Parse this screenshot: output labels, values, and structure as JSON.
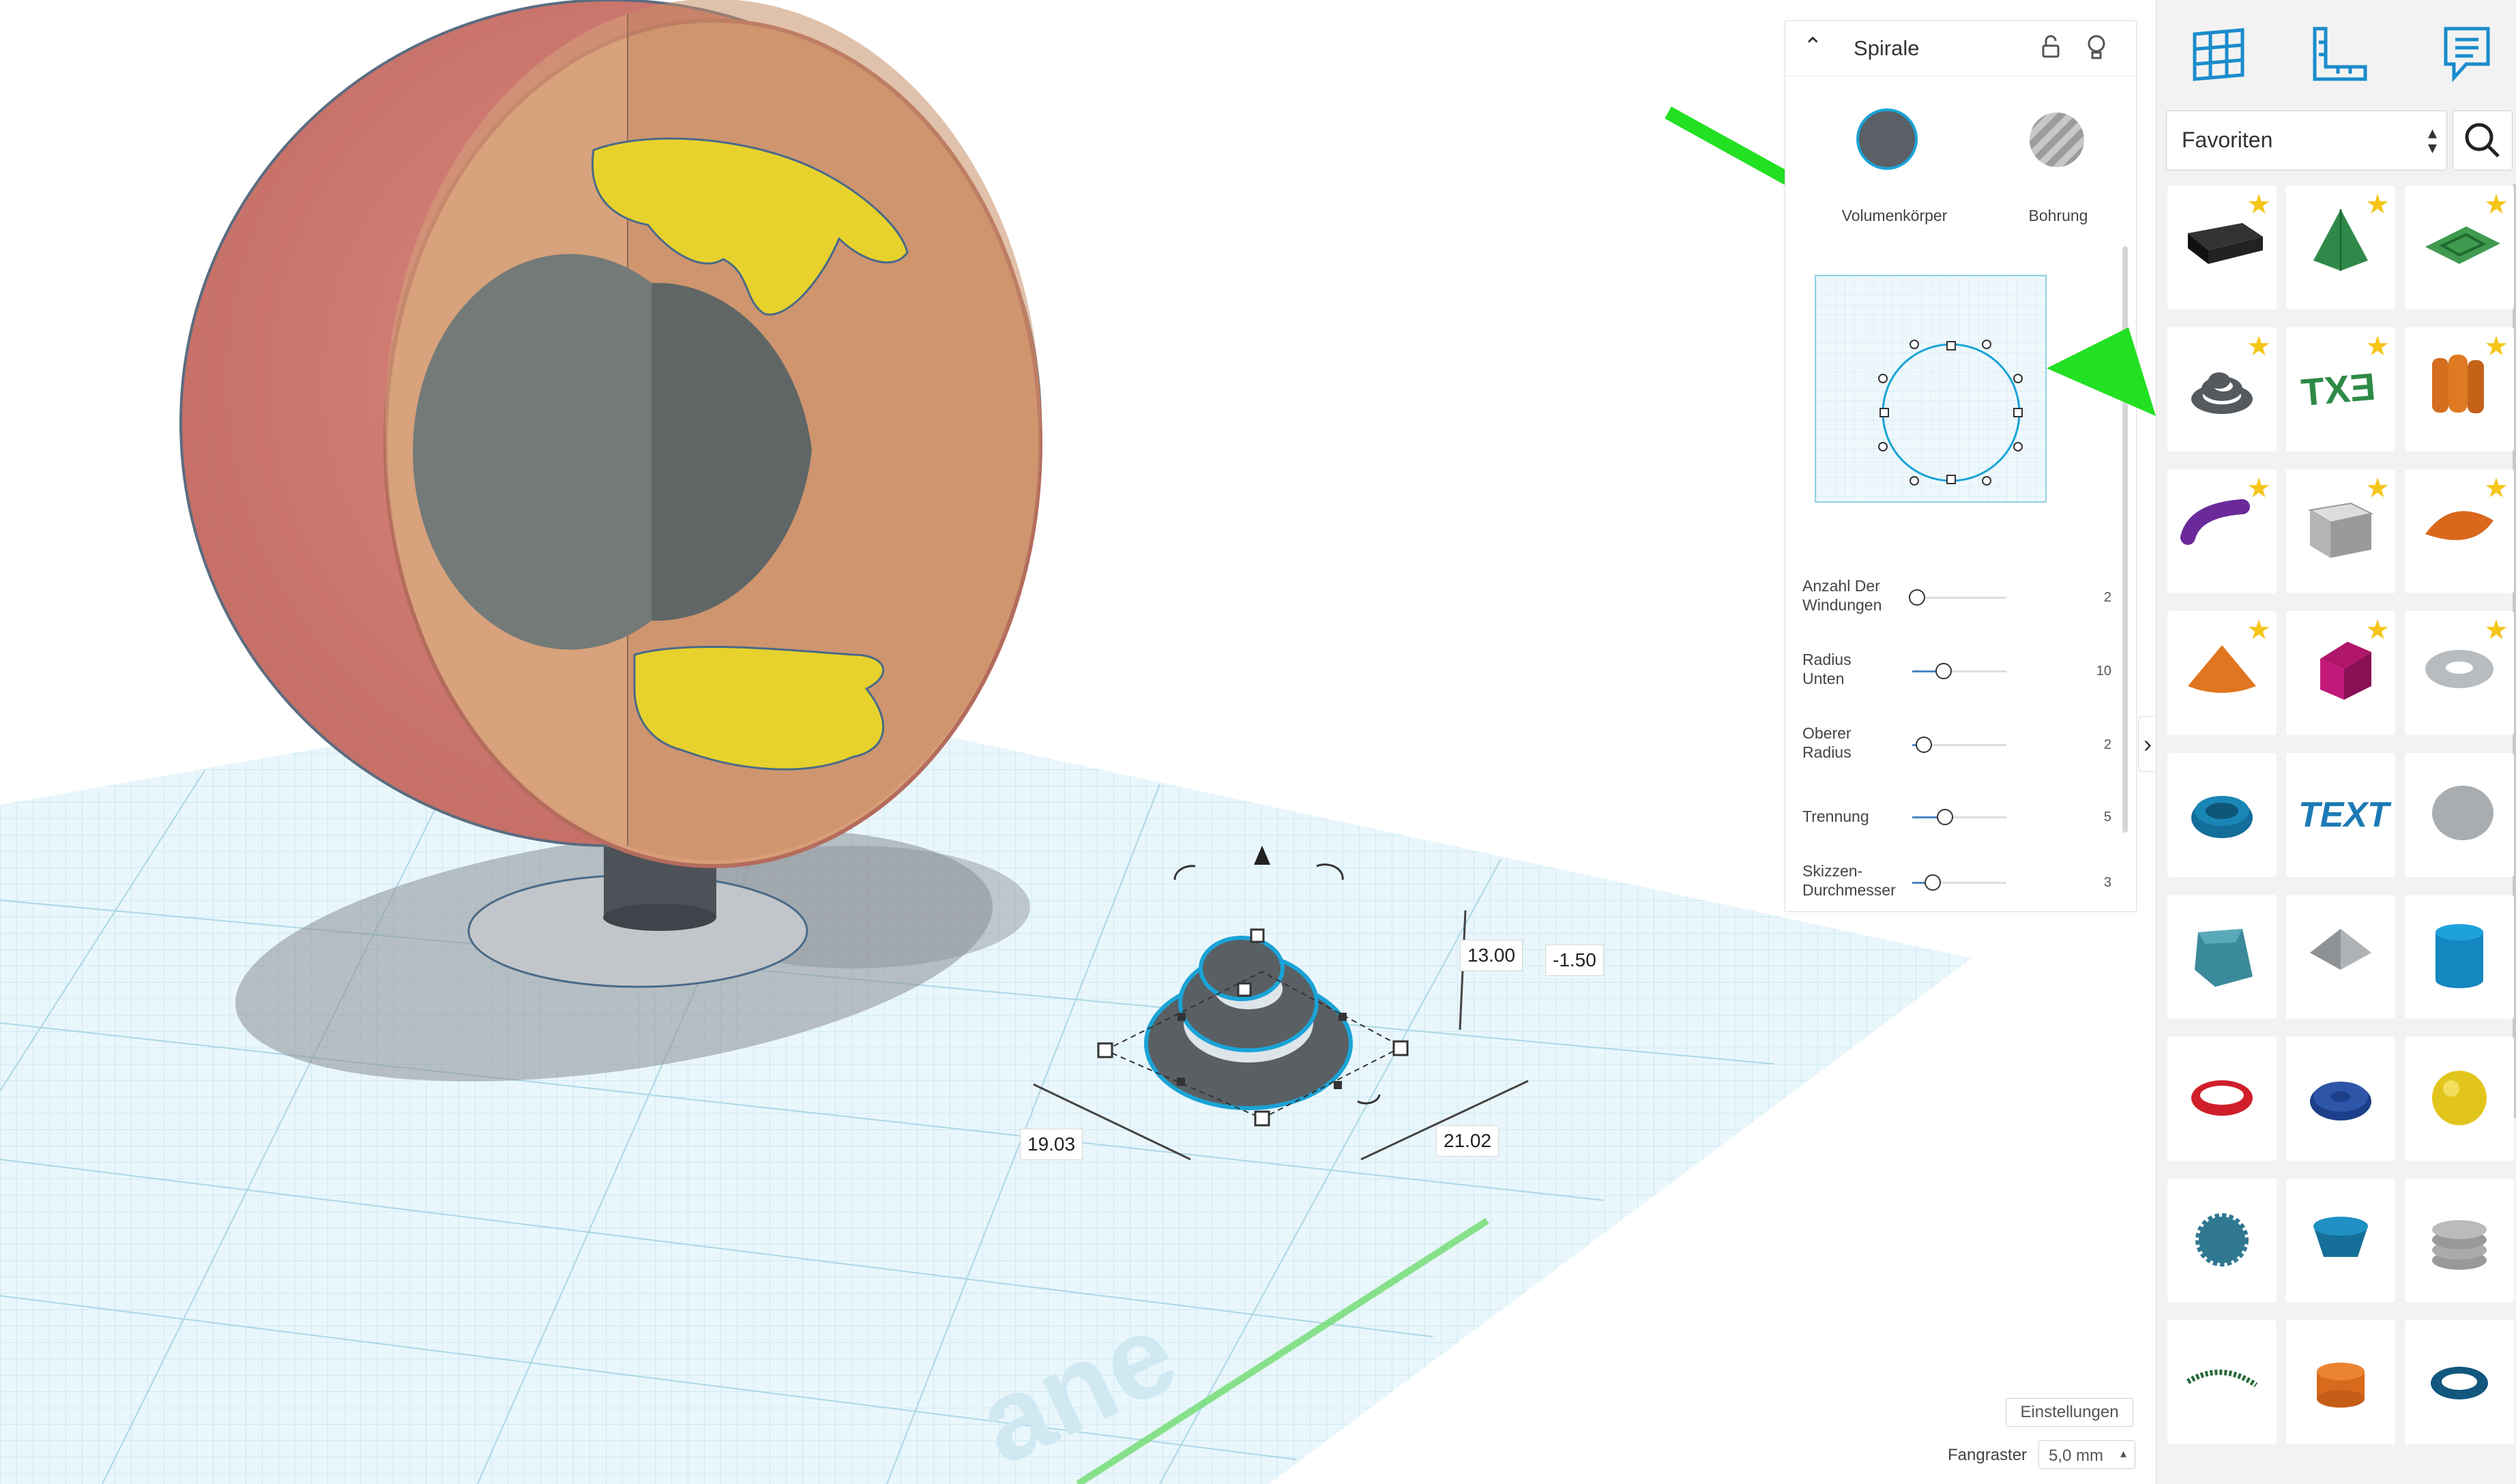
{
  "inspector": {
    "shape_name": "Spirale",
    "solid_label": "Volumenkörper",
    "hole_label": "Bohrung",
    "params": [
      {
        "label_line1": "Anzahl Der",
        "label_line2": "Windungen",
        "value": "2",
        "slider_fraction": 0.05
      },
      {
        "label_line1": "Radius",
        "label_line2": "Unten",
        "value": "10",
        "slider_fraction": 0.33
      },
      {
        "label_line1": "Oberer",
        "label_line2": "Radius",
        "value": "2",
        "slider_fraction": 0.12
      },
      {
        "label_line1": "Trennung",
        "label_line2": "",
        "value": "5",
        "slider_fraction": 0.35
      },
      {
        "label_line1": "Skizzen-",
        "label_line2": "Durchmesser",
        "value": "3",
        "slider_fraction": 0.22
      }
    ]
  },
  "dimensions": {
    "height": "13.00",
    "elevation": "-1.50",
    "length": "19.03",
    "width": "21.02"
  },
  "library": {
    "category": "Favoriten",
    "tool_icons": [
      "grid-icon",
      "ruler-icon",
      "notes-icon"
    ],
    "shapes": [
      {
        "name": "box-black",
        "favorite": true
      },
      {
        "name": "cone-green",
        "favorite": true
      },
      {
        "name": "square-spiral-green",
        "favorite": true
      },
      {
        "name": "spiral-gray",
        "favorite": true
      },
      {
        "name": "text-green",
        "favorite": true
      },
      {
        "name": "cylinders-orange",
        "favorite": true
      },
      {
        "name": "tube-purple",
        "favorite": true
      },
      {
        "name": "box-hollow-gray",
        "favorite": true
      },
      {
        "name": "leaf-orange",
        "favorite": true
      },
      {
        "name": "cone-orange",
        "favorite": true
      },
      {
        "name": "house-magenta",
        "favorite": true
      },
      {
        "name": "torus-gray",
        "favorite": true
      },
      {
        "name": "gear-ring-blue",
        "favorite": false
      },
      {
        "name": "text-3d-blue",
        "favorite": false
      },
      {
        "name": "egg-gray",
        "favorite": false
      },
      {
        "name": "twisted-polygon-teal",
        "favorite": false
      },
      {
        "name": "diamond-gray",
        "favorite": false
      },
      {
        "name": "cylinder-blue",
        "favorite": false
      },
      {
        "name": "ring-red",
        "favorite": false
      },
      {
        "name": "button-blue",
        "favorite": false
      },
      {
        "name": "sphere-yellow",
        "favorite": false
      },
      {
        "name": "gear-teal",
        "favorite": false
      },
      {
        "name": "bowl-blue",
        "favorite": false
      },
      {
        "name": "screw-gray",
        "favorite": false
      },
      {
        "name": "arc-green",
        "favorite": false
      },
      {
        "name": "cylinder-orange",
        "favorite": false
      },
      {
        "name": "ring-blue",
        "favorite": false
      }
    ]
  },
  "footer": {
    "settings_label": "Einstellungen",
    "snap_label": "Fangraster",
    "snap_value": "5,0 mm"
  },
  "colors": {
    "accent": "#1aa3d6",
    "arrow": "#22e022",
    "star": "#f5c518",
    "grid": "#bfe3ef"
  }
}
